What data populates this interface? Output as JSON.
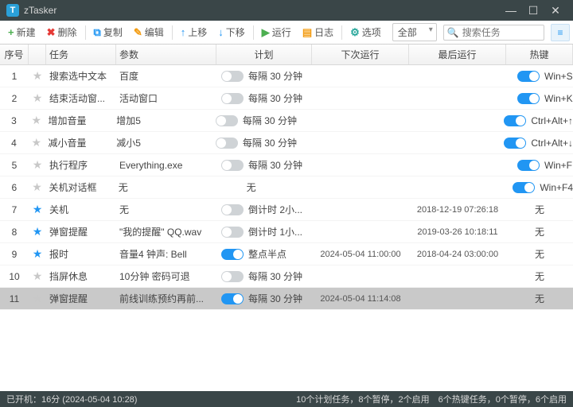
{
  "window": {
    "title": "zTasker"
  },
  "toolbar": {
    "new": "新建",
    "delete": "删除",
    "copy": "复制",
    "edit": "编辑",
    "up": "上移",
    "down": "下移",
    "run": "运行",
    "log": "日志",
    "options": "选项"
  },
  "filter": {
    "label": "全部"
  },
  "search": {
    "placeholder": "搜索任务"
  },
  "columns": {
    "num": "序号",
    "task": "任务",
    "param": "参数",
    "plan": "计划",
    "next": "下次运行",
    "last": "最后运行",
    "hot": "热键"
  },
  "rows": [
    {
      "num": "1",
      "star": false,
      "task": "搜索选中文本",
      "param": "百度",
      "enabled": false,
      "plan": "每隔 30 分钟",
      "next": "",
      "last": "",
      "hotEnabled": true,
      "hot": "Win+S"
    },
    {
      "num": "2",
      "star": false,
      "task": "结束活动窗...",
      "param": "活动窗口",
      "enabled": false,
      "plan": "每隔 30 分钟",
      "next": "",
      "last": "",
      "hotEnabled": true,
      "hot": "Win+K"
    },
    {
      "num": "3",
      "star": false,
      "task": "增加音量",
      "param": "增加5",
      "enabled": false,
      "plan": "每隔 30 分钟",
      "next": "",
      "last": "",
      "hotEnabled": true,
      "hot": "Ctrl+Alt+↑"
    },
    {
      "num": "4",
      "star": false,
      "task": "减小音量",
      "param": "减小5",
      "enabled": false,
      "plan": "每隔 30 分钟",
      "next": "",
      "last": "",
      "hotEnabled": true,
      "hot": "Ctrl+Alt+↓"
    },
    {
      "num": "5",
      "star": false,
      "task": "执行程序",
      "param": "Everything.exe",
      "enabled": false,
      "plan": "每隔 30 分钟",
      "next": "",
      "last": "",
      "hotEnabled": true,
      "hot": "Win+F"
    },
    {
      "num": "6",
      "star": false,
      "task": "关机对话框",
      "param": "无",
      "enabled": false,
      "plan": "无",
      "next": "",
      "last": "",
      "hotEnabled": true,
      "hot": "Win+F4"
    },
    {
      "num": "7",
      "star": true,
      "task": "关机",
      "param": "无",
      "enabled": false,
      "plan": "倒计时 2小...",
      "next": "",
      "last": "2018-12-19 07:26:18",
      "hotEnabled": false,
      "hot": "无"
    },
    {
      "num": "8",
      "star": true,
      "task": "弹窗提醒",
      "param": "\"我的提醒\" QQ.wav",
      "enabled": false,
      "plan": "倒计时 1小...",
      "next": "",
      "last": "2019-03-26 10:18:11",
      "hotEnabled": false,
      "hot": "无"
    },
    {
      "num": "9",
      "star": true,
      "task": "报时",
      "param": "音量4 钟声: Bell",
      "enabled": true,
      "plan": "整点半点",
      "next": "2024-05-04 11:00:00",
      "last": "2018-04-24 03:00:00",
      "hotEnabled": false,
      "hot": "无"
    },
    {
      "num": "10",
      "star": false,
      "task": "挡屏休息",
      "param": "10分钟 密码可退",
      "enabled": false,
      "plan": "每隔 30 分钟",
      "next": "",
      "last": "",
      "hotEnabled": false,
      "hot": "无"
    },
    {
      "num": "11",
      "star": false,
      "task": "弹窗提醒",
      "param": "前线训练预约再前...",
      "enabled": true,
      "plan": "每隔 30 分钟",
      "next": "2024-05-04 11:14:08",
      "last": "",
      "hotEnabled": false,
      "hot": "无",
      "selected": true
    }
  ],
  "status": {
    "left": "已开机：16分 (2024-05-04 10:28)",
    "right": "10个计划任务，8个暂停，2个启用　6个热键任务，0个暂停，6个启用"
  }
}
